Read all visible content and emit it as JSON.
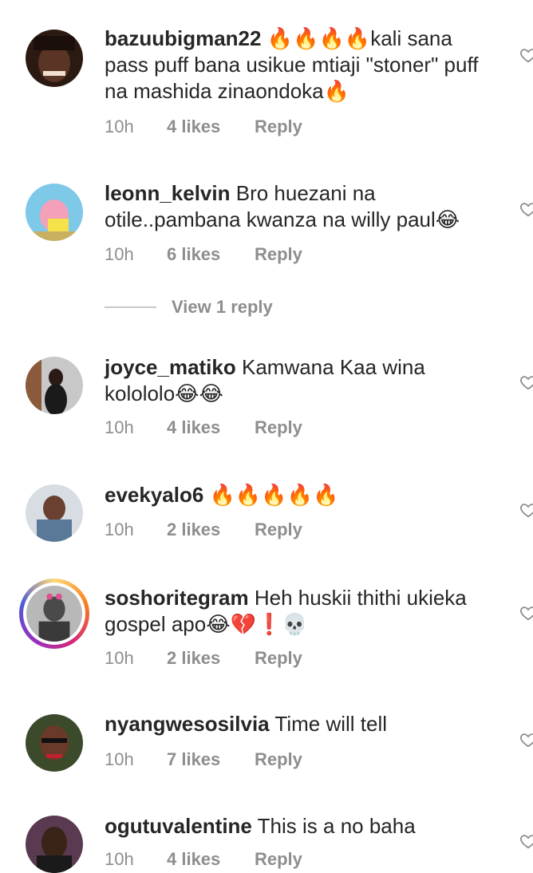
{
  "comments": [
    {
      "username": "bazuubigman22",
      "text": "🔥🔥🔥🔥kali sana pass puff bana usikue mtiaji \"stoner\" puff na mashida zinaondoka🔥",
      "time": "10h",
      "likes": "4 likes",
      "reply": "Reply"
    },
    {
      "username": "leonn_kelvin",
      "text": "Bro huezani na otile..pambana kwanza na willy paul😂",
      "time": "10h",
      "likes": "6 likes",
      "reply": "Reply"
    },
    {
      "username": "joyce_matiko",
      "text": "Kamwana Kaa wina kolololo😂😂",
      "time": "10h",
      "likes": "4 likes",
      "reply": "Reply"
    },
    {
      "username": "evekyalo6",
      "text": "🔥🔥🔥🔥🔥",
      "time": "10h",
      "likes": "2 likes",
      "reply": "Reply"
    },
    {
      "username": "soshoritegram",
      "text": "Heh huskii thithi ukieka gospel apo😂💔❗💀",
      "time": "10h",
      "likes": "2 likes",
      "reply": "Reply"
    },
    {
      "username": "nyangwesosilvia",
      "text": "Time will tell",
      "time": "10h",
      "likes": "7 likes",
      "reply": "Reply"
    },
    {
      "username": "ogutuvalentine",
      "text": "This is a no baha",
      "time": "10h",
      "likes": "4 likes",
      "reply": "Reply"
    }
  ],
  "view_replies": "View 1 reply",
  "icons": {
    "like": "heart-outline-icon"
  },
  "colors": {
    "text": "#262626",
    "secondary": "#8e8e8e",
    "story_ring": "#d62976"
  }
}
